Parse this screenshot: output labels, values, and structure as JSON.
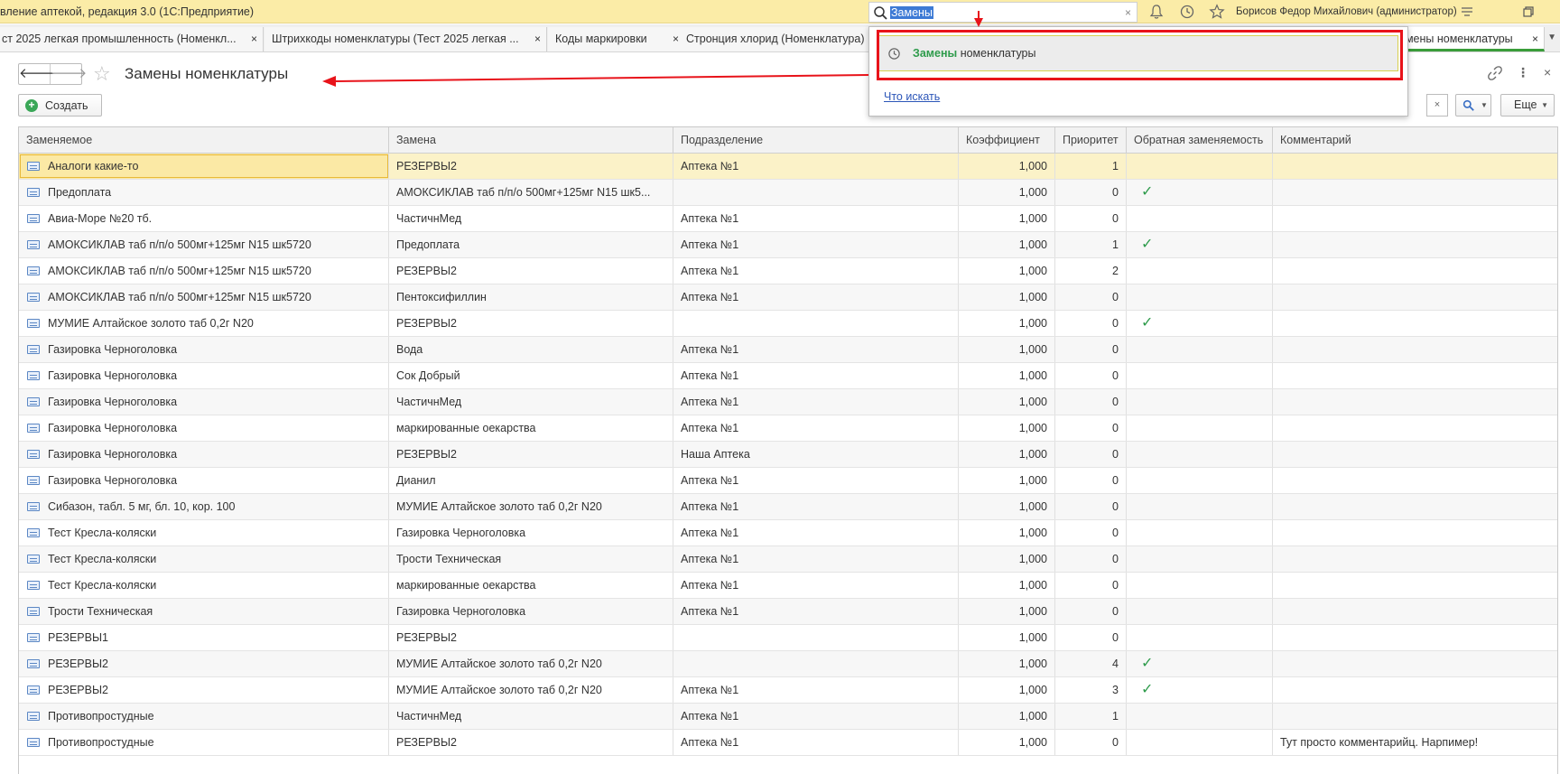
{
  "app": {
    "title": "вление аптекой, редакция 3.0 (1С:Предприятие)",
    "user": "Борисов Федор Михайлович (администратор)"
  },
  "search": {
    "value": "Замены",
    "clear": "×",
    "suggestion_match": "Замены",
    "suggestion_rest": " номенклатуры",
    "what_to_search": "Что искать"
  },
  "tabs": [
    {
      "label": "ст 2025 легкая промышленность (Номенкл...",
      "close": "×"
    },
    {
      "label": "Штрихкоды номенклатуры (Тест 2025 легкая ...",
      "close": "×"
    },
    {
      "label": "Коды маркировки",
      "close": "×"
    },
    {
      "label": "Стронция хлорид (Номенклатура)",
      "close": ""
    },
    {
      "label": "амены номенклатуры",
      "close": "×"
    }
  ],
  "form": {
    "title": "Замены номенклатуры",
    "create_label": "Создать",
    "more_label": "Еще",
    "list_clear": "×"
  },
  "table": {
    "columns": [
      "Заменяемое",
      "Замена",
      "Подразделение",
      "Коэффициент",
      "Приоритет",
      "Обратная заменяемость",
      "Комментарий"
    ],
    "rows": [
      {
        "replaced": "Аналоги какие-то",
        "replacement": "РЕЗЕРВЫ2",
        "division": "Аптека №1",
        "coef": "1,000",
        "priority": "1",
        "reverse": false,
        "comment": ""
      },
      {
        "replaced": "Предоплата",
        "replacement": "АМОКСИКЛАВ таб п/п/о 500мг+125мг N15 шк5...",
        "division": "",
        "coef": "1,000",
        "priority": "0",
        "reverse": true,
        "comment": ""
      },
      {
        "replaced": "Авиа-Море №20 тб.",
        "replacement": "ЧастичнМед",
        "division": "Аптека №1",
        "coef": "1,000",
        "priority": "0",
        "reverse": false,
        "comment": ""
      },
      {
        "replaced": "АМОКСИКЛАВ таб п/п/о 500мг+125мг N15 шк5720",
        "replacement": "Предоплата",
        "division": "Аптека №1",
        "coef": "1,000",
        "priority": "1",
        "reverse": true,
        "comment": ""
      },
      {
        "replaced": "АМОКСИКЛАВ таб п/п/о 500мг+125мг N15 шк5720",
        "replacement": "РЕЗЕРВЫ2",
        "division": "Аптека №1",
        "coef": "1,000",
        "priority": "2",
        "reverse": false,
        "comment": ""
      },
      {
        "replaced": "АМОКСИКЛАВ таб п/п/о 500мг+125мг N15 шк5720",
        "replacement": "Пентоксифиллин",
        "division": "Аптека №1",
        "coef": "1,000",
        "priority": "0",
        "reverse": false,
        "comment": ""
      },
      {
        "replaced": "МУМИЕ Алтайское золото таб 0,2г N20",
        "replacement": "РЕЗЕРВЫ2",
        "division": "",
        "coef": "1,000",
        "priority": "0",
        "reverse": true,
        "comment": ""
      },
      {
        "replaced": "Газировка Черноголовка",
        "replacement": "Вода",
        "division": "Аптека №1",
        "coef": "1,000",
        "priority": "0",
        "reverse": false,
        "comment": ""
      },
      {
        "replaced": "Газировка Черноголовка",
        "replacement": "Сок Добрый",
        "division": "Аптека №1",
        "coef": "1,000",
        "priority": "0",
        "reverse": false,
        "comment": ""
      },
      {
        "replaced": "Газировка Черноголовка",
        "replacement": "ЧастичнМед",
        "division": "Аптека №1",
        "coef": "1,000",
        "priority": "0",
        "reverse": false,
        "comment": ""
      },
      {
        "replaced": "Газировка Черноголовка",
        "replacement": "маркированные оекарства",
        "division": "Аптека №1",
        "coef": "1,000",
        "priority": "0",
        "reverse": false,
        "comment": ""
      },
      {
        "replaced": "Газировка Черноголовка",
        "replacement": "РЕЗЕРВЫ2",
        "division": "Наша Аптека",
        "coef": "1,000",
        "priority": "0",
        "reverse": false,
        "comment": ""
      },
      {
        "replaced": "Газировка Черноголовка",
        "replacement": "Дианил",
        "division": "Аптека №1",
        "coef": "1,000",
        "priority": "0",
        "reverse": false,
        "comment": ""
      },
      {
        "replaced": "Сибазон, табл. 5 мг, бл. 10, кор. 100",
        "replacement": "МУМИЕ Алтайское золото таб 0,2г N20",
        "division": "Аптека №1",
        "coef": "1,000",
        "priority": "0",
        "reverse": false,
        "comment": ""
      },
      {
        "replaced": "Тест Кресла-коляски",
        "replacement": "Газировка Черноголовка",
        "division": "Аптека №1",
        "coef": "1,000",
        "priority": "0",
        "reverse": false,
        "comment": ""
      },
      {
        "replaced": "Тест Кресла-коляски",
        "replacement": "Трости Техническая",
        "division": "Аптека №1",
        "coef": "1,000",
        "priority": "0",
        "reverse": false,
        "comment": ""
      },
      {
        "replaced": "Тест Кресла-коляски",
        "replacement": "маркированные оекарства",
        "division": "Аптека №1",
        "coef": "1,000",
        "priority": "0",
        "reverse": false,
        "comment": ""
      },
      {
        "replaced": "Трости Техническая",
        "replacement": "Газировка Черноголовка",
        "division": "Аптека №1",
        "coef": "1,000",
        "priority": "0",
        "reverse": false,
        "comment": ""
      },
      {
        "replaced": "РЕЗЕРВЫ1",
        "replacement": "РЕЗЕРВЫ2",
        "division": "",
        "coef": "1,000",
        "priority": "0",
        "reverse": false,
        "comment": ""
      },
      {
        "replaced": "РЕЗЕРВЫ2",
        "replacement": "МУМИЕ Алтайское золото таб 0,2г N20",
        "division": "",
        "coef": "1,000",
        "priority": "4",
        "reverse": true,
        "comment": ""
      },
      {
        "replaced": "РЕЗЕРВЫ2",
        "replacement": "МУМИЕ Алтайское золото таб 0,2г N20",
        "division": "Аптека №1",
        "coef": "1,000",
        "priority": "3",
        "reverse": true,
        "comment": ""
      },
      {
        "replaced": "Противопростудные",
        "replacement": "ЧастичнМед",
        "division": "Аптека №1",
        "coef": "1,000",
        "priority": "1",
        "reverse": false,
        "comment": ""
      },
      {
        "replaced": "Противопростудные",
        "replacement": "РЕЗЕРВЫ2",
        "division": "Аптека №1",
        "coef": "1,000",
        "priority": "0",
        "reverse": false,
        "comment": "Тут просто комментарийц. Нарпимер!"
      }
    ]
  },
  "colors": {
    "titlebar": "#fbeca7",
    "accent_green": "#2e9b4b",
    "annotation_red": "#e8131a",
    "selected_row": "#fbf2c8"
  },
  "icons": [
    "search-icon",
    "bell-icon",
    "history-icon",
    "star-icon",
    "menu-icon",
    "restore-window-icon",
    "link-icon",
    "kebab-menu-icon",
    "close-icon",
    "check-icon",
    "catalog-item-icon"
  ]
}
